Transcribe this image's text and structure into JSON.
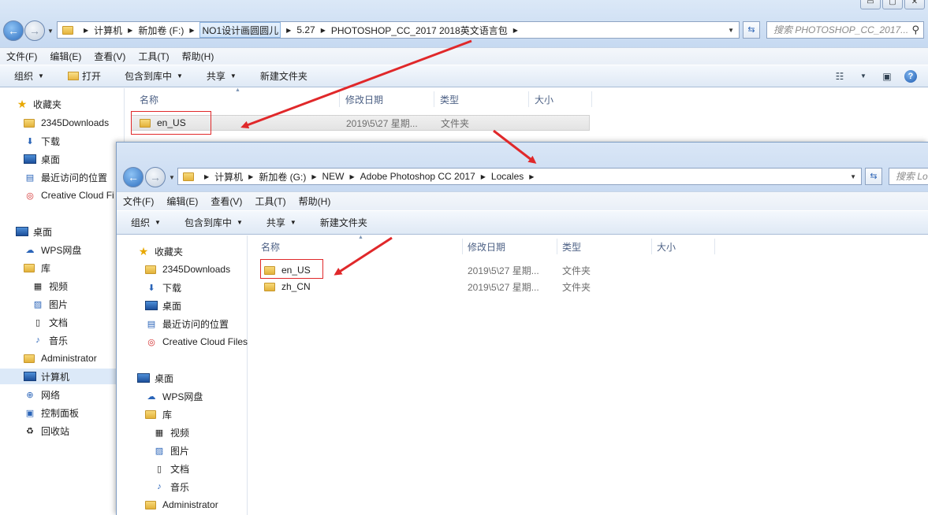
{
  "window1": {
    "controls": {
      "minimize": "▭",
      "maximize": "▢",
      "close": "✕"
    },
    "address": {
      "crumbs": [
        "计算机",
        "新加卷 (F:)",
        "NO1设计画圆圆儿",
        "5.27",
        "PHOTOSHOP_CC_2017 2018英文语言包"
      ],
      "highlighted_crumb": "NO1设计画圆圆儿"
    },
    "search_placeholder": "搜索 PHOTOSHOP_CC_2017...",
    "menu": [
      "文件(F)",
      "编辑(E)",
      "查看(V)",
      "工具(T)",
      "帮助(H)"
    ],
    "toolbar": {
      "organize": "组织",
      "open": "打开",
      "include": "包含到库中",
      "share": "共享",
      "new_folder": "新建文件夹"
    },
    "nav": {
      "favorites": "收藏夹",
      "fav_items": [
        "2345Downloads",
        "下载",
        "桌面",
        "最近访问的位置",
        "Creative Cloud Fi"
      ],
      "desktop": "桌面",
      "wps": "WPS网盘",
      "library": "库",
      "lib_items": [
        "视频",
        "图片",
        "文档",
        "音乐"
      ],
      "admin": "Administrator",
      "computer": "计算机",
      "network": "网络",
      "control_panel": "控制面板",
      "recycle": "回收站"
    },
    "columns": {
      "name": "名称",
      "date": "修改日期",
      "type": "类型",
      "size": "大小"
    },
    "files": [
      {
        "name": "en_US",
        "date": "2019\\5\\27 星期...",
        "type": "文件夹"
      }
    ]
  },
  "window2": {
    "address": {
      "crumbs": [
        "计算机",
        "新加卷 (G:)",
        "NEW",
        "Adobe Photoshop CC 2017",
        "Locales"
      ]
    },
    "search_placeholder": "搜索 Lo",
    "menu": [
      "文件(F)",
      "编辑(E)",
      "查看(V)",
      "工具(T)",
      "帮助(H)"
    ],
    "toolbar": {
      "organize": "组织",
      "include": "包含到库中",
      "share": "共享",
      "new_folder": "新建文件夹"
    },
    "nav": {
      "favorites": "收藏夹",
      "fav_items": [
        "2345Downloads",
        "下载",
        "桌面",
        "最近访问的位置",
        "Creative Cloud Files"
      ],
      "desktop": "桌面",
      "wps": "WPS网盘",
      "library": "库",
      "lib_items": [
        "视频",
        "图片",
        "文档",
        "音乐"
      ],
      "admin": "Administrator"
    },
    "columns": {
      "name": "名称",
      "date": "修改日期",
      "type": "类型",
      "size": "大小"
    },
    "files": [
      {
        "name": "en_US",
        "date": "2019\\5\\27 星期...",
        "type": "文件夹"
      },
      {
        "name": "zh_CN",
        "date": "2019\\5\\27 星期...",
        "type": "文件夹"
      }
    ]
  },
  "colors": {
    "annotation_red": "#e0282a",
    "accent_blue": "#2e6fbf"
  }
}
